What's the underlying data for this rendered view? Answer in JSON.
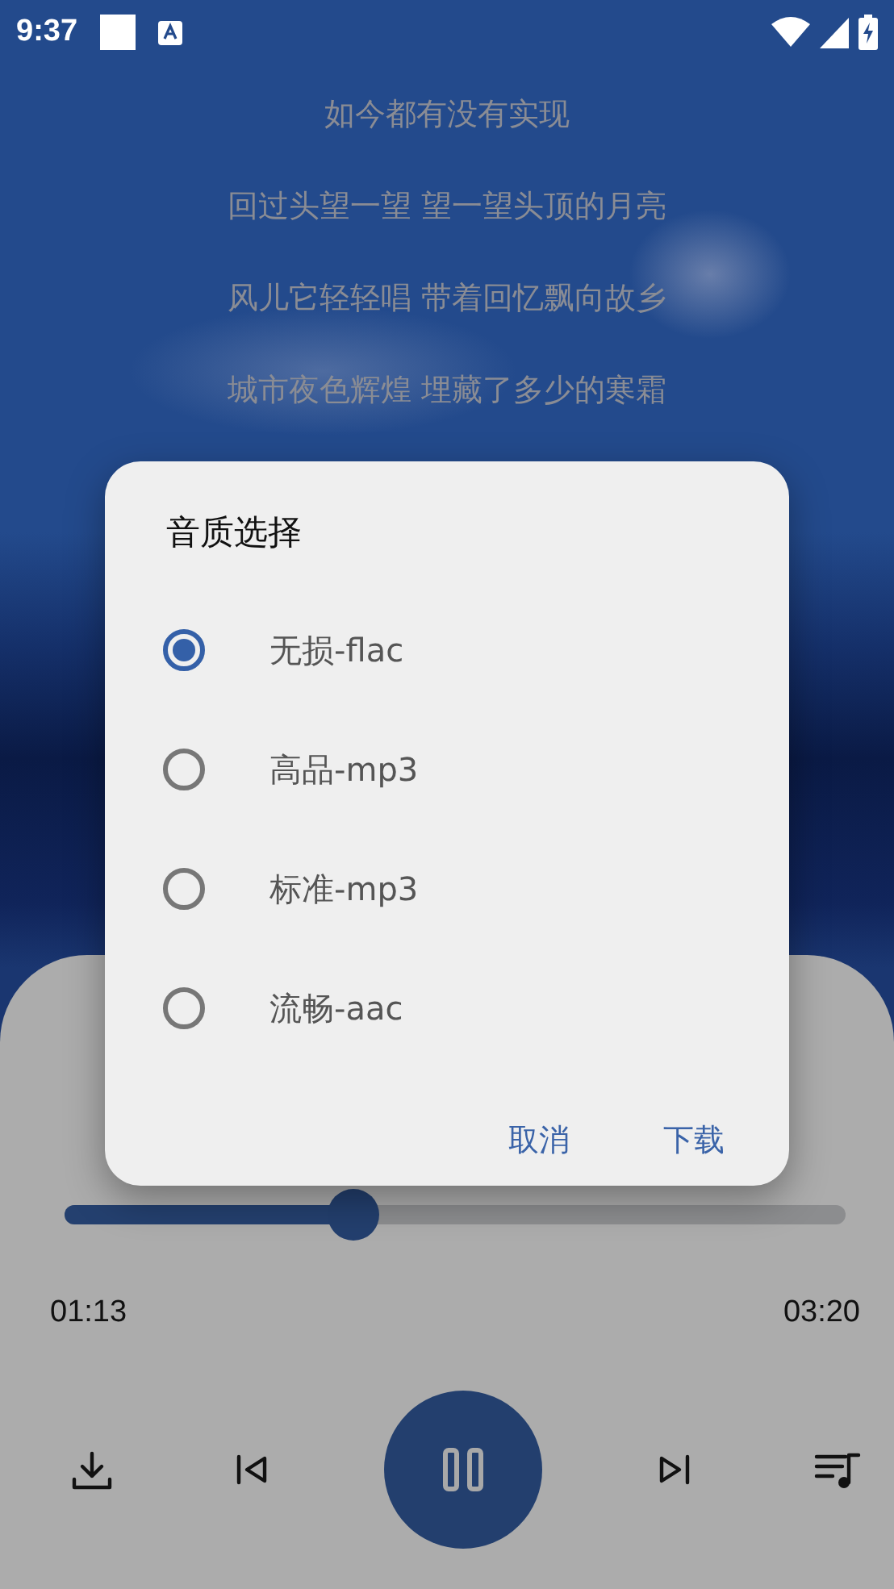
{
  "status_bar": {
    "time": "9:37"
  },
  "lyrics": [
    "如今都有没有实现",
    "回过头望一望 望一望头顶的月亮",
    "风儿它轻轻唱 带着回忆飘向故乡",
    "城市夜色辉煌 埋藏了多少的寒霜"
  ],
  "player": {
    "progress": {
      "level": 0.37
    },
    "elapsed": "01:13",
    "duration": "03:20",
    "playing": true
  },
  "dialog": {
    "title": "音质选择",
    "options": [
      {
        "label": "无损-flac",
        "selected": true
      },
      {
        "label": "高品-mp3",
        "selected": false
      },
      {
        "label": "标准-mp3",
        "selected": false
      },
      {
        "label": "流畅-aac",
        "selected": false
      }
    ],
    "buttons": [
      "取消",
      "下载"
    ]
  }
}
